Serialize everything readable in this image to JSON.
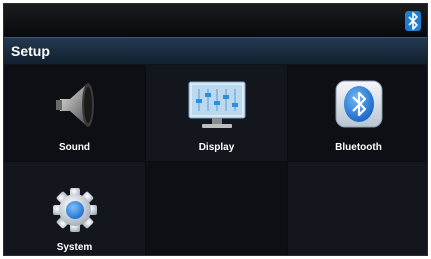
{
  "header": {
    "title": "Setup"
  },
  "status_icons": [
    "bluetooth-icon"
  ],
  "menu": {
    "items": [
      {
        "id": "sound",
        "label": "Sound",
        "icon": "speaker-icon"
      },
      {
        "id": "display",
        "label": "Display",
        "icon": "display-equalizer-icon"
      },
      {
        "id": "bluetooth",
        "label": "Bluetooth",
        "icon": "bluetooth-icon"
      },
      {
        "id": "system",
        "label": "System",
        "icon": "gear-icon"
      }
    ]
  },
  "colors": {
    "background": "#0b0d12",
    "titlebar": "#1b2e42",
    "accent": "#2f8fe0",
    "text": "#ffffff"
  }
}
